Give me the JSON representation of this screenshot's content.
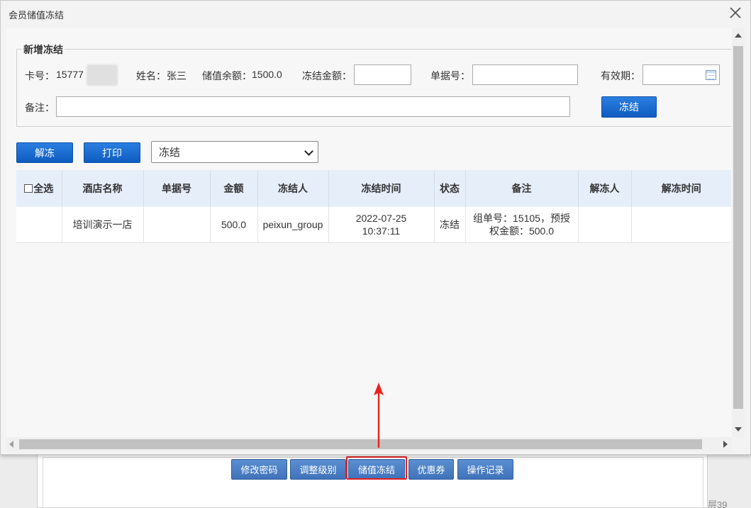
{
  "background": {
    "buttons": [
      "修改密码",
      "调整级别",
      "储值冻结",
      "优惠券",
      "操作记录"
    ],
    "corner_text": "层39"
  },
  "dialog": {
    "title": "会员储值冻结",
    "close_icon": "close-icon"
  },
  "form": {
    "legend": "新增冻结",
    "card_label": "卡号：",
    "card_value": "15777",
    "name_label": "姓名：",
    "name_value": "张三",
    "balance_label": "储值余额：",
    "balance_value": "1500.0",
    "freeze_amount_label": "冻结金额：",
    "freeze_amount_value": "",
    "receipt_label": "单据号：",
    "receipt_value": "",
    "validity_label": "有效期：",
    "validity_value": "",
    "calendar_icon": "calendar-icon",
    "remark_label": "备注：",
    "remark_value": "",
    "freeze_button": "冻结"
  },
  "toolbar": {
    "unfreeze_button": "解冻",
    "print_button": "打印",
    "status_select": "冻结"
  },
  "table": {
    "select_all_label": "全选",
    "columns": [
      "酒店名称",
      "单据号",
      "金额",
      "冻结人",
      "冻结时间",
      "状态",
      "备注",
      "解冻人",
      "解冻时间"
    ],
    "rows": [
      {
        "hotel": "培训演示一店",
        "receipt": "",
        "amount": "500.0",
        "operator": "peixun_group",
        "freeze_date": "2022-07-25",
        "freeze_time": "10:37:11",
        "status": "冻结",
        "remark_line1": "组单号：15105，预授",
        "remark_line2": "权金额：500.0",
        "unfreezer": "",
        "unfreeze_time": ""
      }
    ]
  },
  "colors": {
    "primary_button": "#1565c8",
    "header_bg": "#e6eefa",
    "highlight": "#e02020"
  }
}
